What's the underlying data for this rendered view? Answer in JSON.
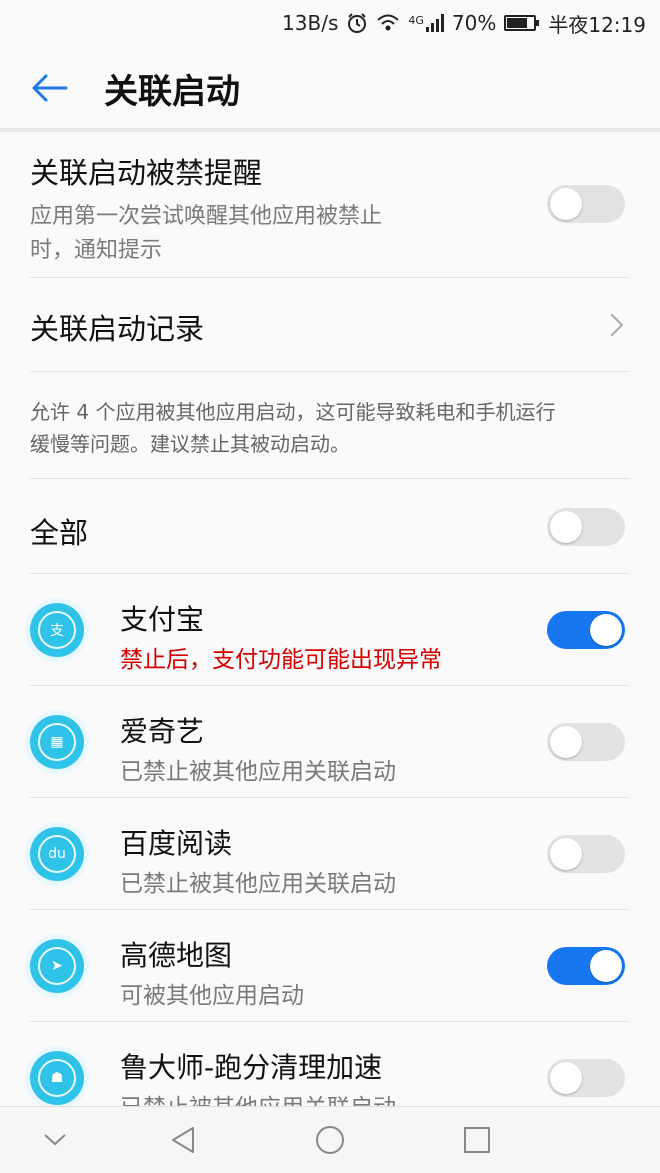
{
  "status": {
    "speed": "13B/s",
    "battery_percent": "70%",
    "network": "4G",
    "time": "半夜12:19",
    "icons": [
      "alarm-icon",
      "wifi-icon",
      "signal-icon",
      "battery-icon"
    ]
  },
  "header": {
    "title": "关联启动",
    "back_icon": "back-arrow-icon"
  },
  "settings": {
    "blocked_reminder": {
      "title": "关联启动被禁提醒",
      "description_line1": "应用第一次尝试唤醒其他应用被禁止",
      "description_line2": "时，通知提示",
      "enabled": false
    },
    "record": {
      "title": "关联启动记录"
    },
    "hint_line1": "允许 4 个应用被其他应用启动，这可能导致耗电和手机运行",
    "hint_line2": "缓慢等问题。建议禁止其被动启动。",
    "all": {
      "label": "全部",
      "enabled": false
    }
  },
  "apps": [
    {
      "name": "支付宝",
      "status": "禁止后，支付功能可能出现异常",
      "enabled": true,
      "icon": "alipay-icon",
      "warning": true
    },
    {
      "name": "爱奇艺",
      "status": "已禁止被其他应用关联启动",
      "enabled": false,
      "icon": "iqiyi-icon",
      "warning": false
    },
    {
      "name": "百度阅读",
      "status": "已禁止被其他应用关联启动",
      "enabled": false,
      "icon": "baidu-reader-icon",
      "warning": false
    },
    {
      "name": "高德地图",
      "status": "可被其他应用启动",
      "enabled": true,
      "icon": "amap-icon",
      "warning": false
    },
    {
      "name": "鲁大师-跑分清理加速",
      "status": "已禁止被其他应用关联启动",
      "enabled": false,
      "icon": "ludashi-icon",
      "warning": false
    }
  ],
  "colors": {
    "accent": "#1677f0",
    "warning": "#d40000",
    "icon_bg": "#2fc3ea"
  },
  "navbar": {
    "icons": [
      "collapse-icon",
      "back-icon",
      "home-icon",
      "recents-icon"
    ]
  }
}
